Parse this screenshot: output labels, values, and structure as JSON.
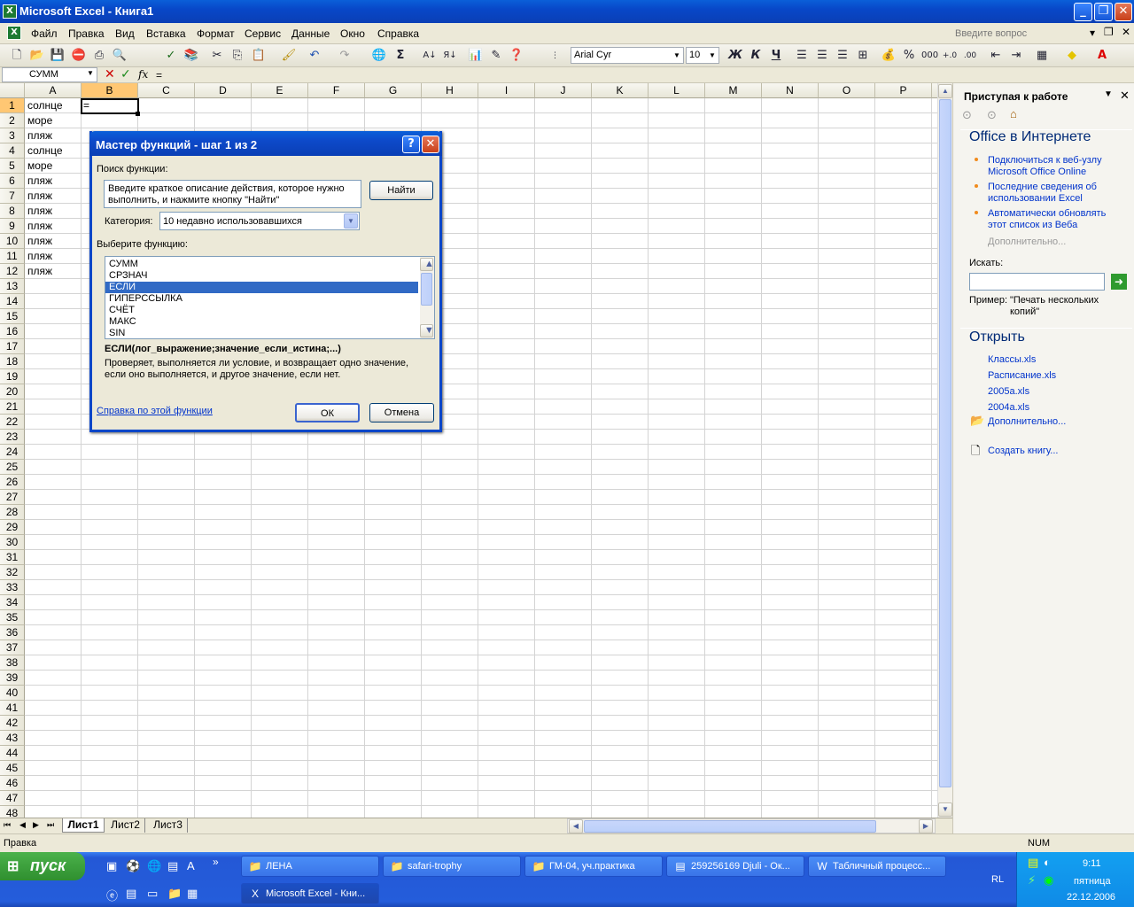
{
  "window": {
    "title": "Microsoft Excel - Книга1"
  },
  "menu": {
    "items": [
      "Файл",
      "Правка",
      "Вид",
      "Вставка",
      "Формат",
      "Сервис",
      "Данные",
      "Окно",
      "Справка"
    ],
    "ask_placeholder": "Введите вопрос"
  },
  "toolbar": {
    "font": "Arial Cyr",
    "size": "10",
    "bold": "Ж",
    "italic": "К",
    "underline": "Ч",
    "percent": "%",
    "thousands": "000"
  },
  "formula_bar": {
    "name_box": "СУММ",
    "fx": "fx",
    "formula": "="
  },
  "grid": {
    "columns": [
      "A",
      "B",
      "C",
      "D",
      "E",
      "F",
      "G",
      "H",
      "I",
      "J",
      "K",
      "L",
      "M",
      "N",
      "O",
      "P"
    ],
    "selected_column": "B",
    "row_count": 48,
    "selected_row": 1,
    "colA_values": [
      "солнце",
      "море",
      "пляж",
      "солнце",
      "море",
      "пляж",
      "пляж",
      "пляж",
      "пляж",
      "пляж",
      "пляж",
      "пляж"
    ],
    "active_cell_value": "="
  },
  "sheets": {
    "tabs": [
      "Лист1",
      "Лист2",
      "Лист3"
    ],
    "active": "Лист1"
  },
  "dialog": {
    "title": "Мастер функций - шаг 1 из 2",
    "search_label": "Поиск функции:",
    "search_text": "Введите краткое описание действия, которое нужно выполнить, и нажмите кнопку \"Найти\"",
    "find_button": "Найти",
    "category_label": "Категория:",
    "category_value": "10 недавно использовавшихся",
    "select_label": "Выберите функцию:",
    "functions": [
      "СУММ",
      "СРЗНАЧ",
      "ЕСЛИ",
      "ГИПЕРССЫЛКА",
      "СЧЁТ",
      "МАКС",
      "SIN"
    ],
    "selected_function": "ЕСЛИ",
    "signature": "ЕСЛИ(лог_выражение;значение_если_истина;...)",
    "description": "Проверяет, выполняется ли условие, и возвращает одно значение, если оно выполняется, и другое значение, если нет.",
    "help_link": "Справка по этой функции",
    "ok_button": "ОК",
    "cancel_button": "Отмена"
  },
  "task_pane": {
    "title": "Приступая к работе",
    "office_header": "Office в Интернете",
    "links": [
      "Подключиться к веб-узлу Microsoft Office Online",
      "Последние сведения об использовании Excel",
      "Автоматически обновлять этот список из Веба"
    ],
    "more": "Дополнительно...",
    "search_label": "Искать:",
    "example_label": "Пример:",
    "example_text": "\"Печать нескольких копий\"",
    "open_header": "Открыть",
    "files": [
      "Классы.xls",
      "Расписание.xls",
      "2005а.xls",
      "2004а.xls"
    ],
    "more_files": "Дополнительно...",
    "create": "Создать книгу..."
  },
  "status": {
    "left": "Правка",
    "num": "NUM"
  },
  "taskbar": {
    "start": "пуск",
    "tasks_row1": [
      "ЛЕНА",
      "safari-trophy",
      "ГМ-04, уч.практика",
      "259256169 Djuli - Ок...",
      "Табличный процесс..."
    ],
    "tasks_row2": [
      "Microsoft Excel - Кни..."
    ],
    "lang": "RL",
    "time": "9:11",
    "day": "пятница",
    "date": "22.12.2006"
  },
  "colors": {
    "titlebar": "#0a4fd0",
    "selection": "#316ac5",
    "taskbar": "#245ddb",
    "start": "#3a9d3a",
    "link": "#0033cc"
  }
}
